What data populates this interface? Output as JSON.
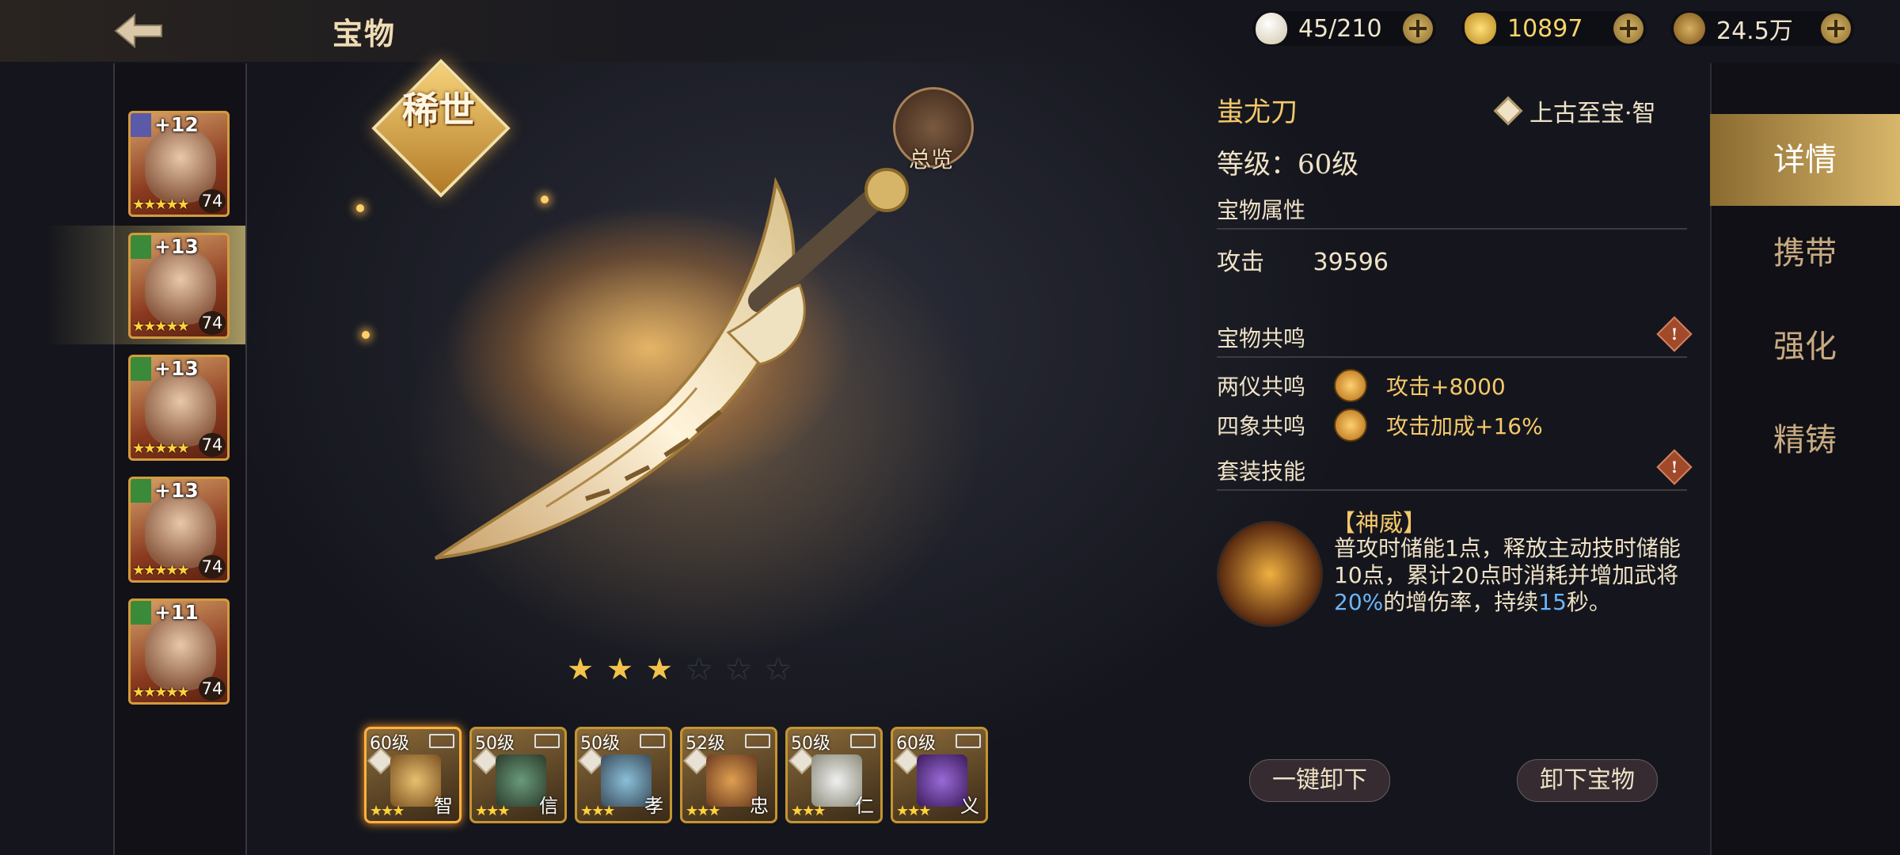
{
  "header": {
    "title": "宝物",
    "currencies": [
      {
        "icon": "stamina-egg-icon",
        "value": "45/210"
      },
      {
        "icon": "gold-ingot-icon",
        "value": "10897"
      },
      {
        "icon": "coin-icon",
        "value": "24.5万"
      }
    ]
  },
  "heroes": [
    {
      "bonus": "+12",
      "stars": "★★★★★",
      "level": "74",
      "badge": "shield-icon"
    },
    {
      "bonus": "+13",
      "stars": "★★★★★",
      "level": "74",
      "badge": "sword-icon"
    },
    {
      "bonus": "+13",
      "stars": "★★★★★",
      "level": "74",
      "badge": "shield-icon"
    },
    {
      "bonus": "+13",
      "stars": "★★★★★",
      "level": "74",
      "badge": "shield-icon"
    },
    {
      "bonus": "+11",
      "stars": "★★★★★",
      "level": "74",
      "badge": "arrow-icon"
    }
  ],
  "showcase": {
    "rarity": "稀世",
    "overview_label": "总览",
    "star_filled": 3,
    "star_total": 6,
    "colors": {
      "star_on": "#f4c24a",
      "star_off": "#1a1c24"
    }
  },
  "slots": [
    {
      "level": "60级",
      "virtue": "智",
      "stars": "★★★"
    },
    {
      "level": "50级",
      "virtue": "信",
      "stars": "★★★"
    },
    {
      "level": "50级",
      "virtue": "孝",
      "stars": "★★★"
    },
    {
      "level": "52级",
      "virtue": "忠",
      "stars": "★★★"
    },
    {
      "level": "50级",
      "virtue": "仁",
      "stars": "★★★"
    },
    {
      "level": "60级",
      "virtue": "义",
      "stars": "★★★"
    }
  ],
  "detail": {
    "name": "蚩尤刀",
    "category": "上古至宝·智",
    "level": "等级：60级",
    "attr_title": "宝物属性",
    "attr_key": "攻击",
    "attr_value": "39596",
    "resonance_title": "宝物共鸣",
    "resonance": [
      {
        "name": "两仪共鸣",
        "effect": "攻击+8000"
      },
      {
        "name": "四象共鸣",
        "effect": "攻击加成+16%"
      }
    ],
    "set_title": "套装技能",
    "skill_name": "【神威】",
    "skill_desc_1": "普攻时储能1点，释放主动技时储能10点，累计20点时消耗并增加武将",
    "skill_desc_hl1": "20%",
    "skill_desc_2": "的增伤率，持续",
    "skill_desc_hl2": "15",
    "skill_desc_3": "秒。",
    "info_mark": "!"
  },
  "actions": {
    "unequip_all": "一键卸下",
    "unequip": "卸下宝物"
  },
  "tabs": [
    "详情",
    "携带",
    "强化",
    "精铸"
  ]
}
